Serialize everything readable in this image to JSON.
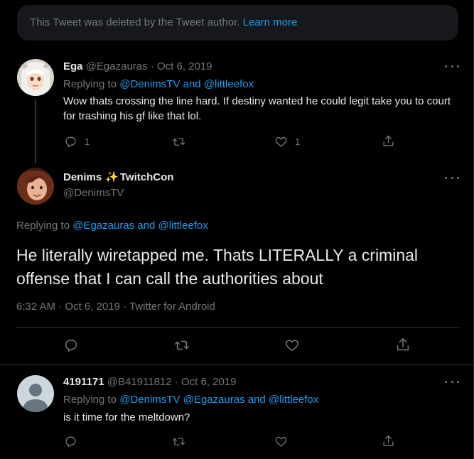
{
  "deleted_notice": {
    "text": "This Tweet was deleted by the Tweet author.",
    "link": "Learn more"
  },
  "tweet1": {
    "name": "Ega",
    "handle": "@Egazauras",
    "date": "· Oct 6, 2019",
    "replying_label": "Replying to",
    "replying_users": "@DenimsTV and @littleefox",
    "text": "Wow thats crossing the line hard. If destiny wanted he could legit take you to court for trashing his gf like that lol.",
    "reply_count": "1",
    "like_count": "1"
  },
  "main_tweet": {
    "name": "Denims",
    "name_suffix": "TwitchCon",
    "emoji": "✨",
    "handle": "@DenimsTV",
    "replying_label": "Replying to",
    "replying_users": "@Egazauras and @littleefox",
    "text": "He literally wiretapped me. Thats LITERALLY a criminal offense that I can call the authorities about",
    "time": "6:32 AM · Oct 6, 2019 · Twitter for Android"
  },
  "tweet3": {
    "name": "4191171",
    "handle": "@B41911812",
    "date": "· Oct 6, 2019",
    "replying_label": "Replying to",
    "replying_users": "@DenimsTV @Egazauras and @littleefox",
    "text": "is it time for the meltdown?"
  },
  "colors": {
    "background": "#000000",
    "accent": "#1d9bf0",
    "muted": "#71767b",
    "text": "#e7e9ea",
    "border": "#2f3336"
  },
  "icons": [
    "reply-icon",
    "retweet-icon",
    "like-icon",
    "share-icon",
    "more-icon"
  ]
}
